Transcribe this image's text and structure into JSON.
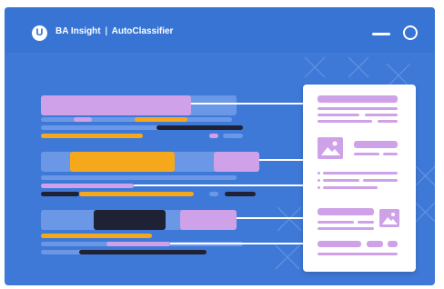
{
  "window": {
    "brand_letter": "U",
    "title_brand": "BA Insight",
    "title_separator": "|",
    "title_product": "AutoClassifier",
    "controls": [
      "minimize-icon",
      "circle-icon"
    ]
  },
  "colors": {
    "background": "#3f79d8",
    "header": "#3874d4",
    "lavender": "#cfa1e8",
    "orange": "#f6a81c",
    "dark": "#1f2235",
    "light_blue": "#6a98e6",
    "card": "#ffffff"
  },
  "illustration": {
    "document_rows": 3,
    "card_sections": 4,
    "image_placeholders": [
      "image-icon",
      "image-icon"
    ]
  }
}
